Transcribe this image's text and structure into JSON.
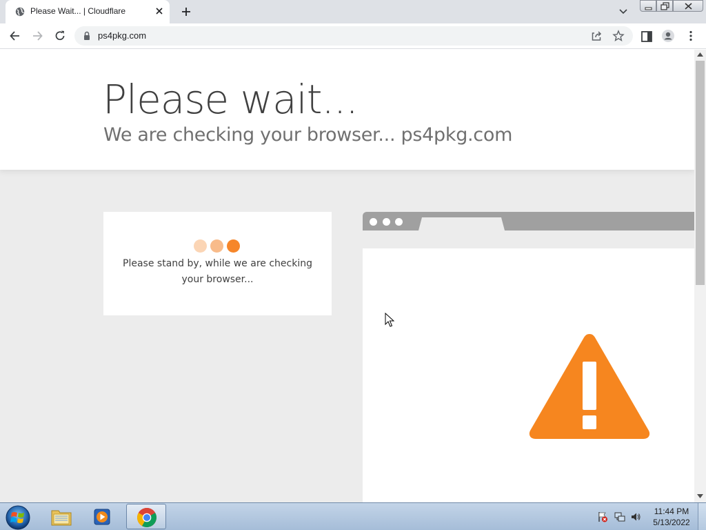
{
  "browser": {
    "tab": {
      "title": "Please Wait... | Cloudflare",
      "favicon": "globe-icon",
      "close": "close-icon"
    },
    "new_tab": "plus-icon",
    "tab_search": "chevron-down-icon",
    "window_controls": [
      "minimize-icon",
      "restore-icon",
      "close-icon"
    ],
    "nav": {
      "back": "arrow-left-icon",
      "forward": "arrow-right-icon",
      "reload": "reload-icon"
    },
    "address_bar": {
      "url": "ps4pkg.com",
      "security": "lock-icon"
    },
    "omnibox_actions": [
      "share-icon",
      "star-icon"
    ],
    "toolbar_actions": [
      "side-panel-icon",
      "profile-icon",
      "menu-icon"
    ]
  },
  "page": {
    "heading": "Please wait...",
    "subheading_prefix": "We are checking your browser...",
    "subheading_domain": "ps4pkg.com",
    "status_text": "Please stand by, while we are checking your browser...",
    "loading_dot_colors": [
      "#fbd5b5",
      "#f8bb8a",
      "#f6862a"
    ],
    "warning_color": "#f6861f",
    "illustration": "browser-mockup-warning"
  },
  "taskbar": {
    "start": "windows-start-icon",
    "items": [
      {
        "name": "explorer",
        "icon": "folder-icon"
      },
      {
        "name": "media-player",
        "icon": "media-player-icon"
      },
      {
        "name": "chrome",
        "icon": "chrome-icon",
        "active": true
      }
    ],
    "tray": [
      "action-center-icon",
      "network-icon",
      "volume-icon"
    ],
    "clock": {
      "time": "11:44 PM",
      "date": "5/13/2022"
    }
  }
}
